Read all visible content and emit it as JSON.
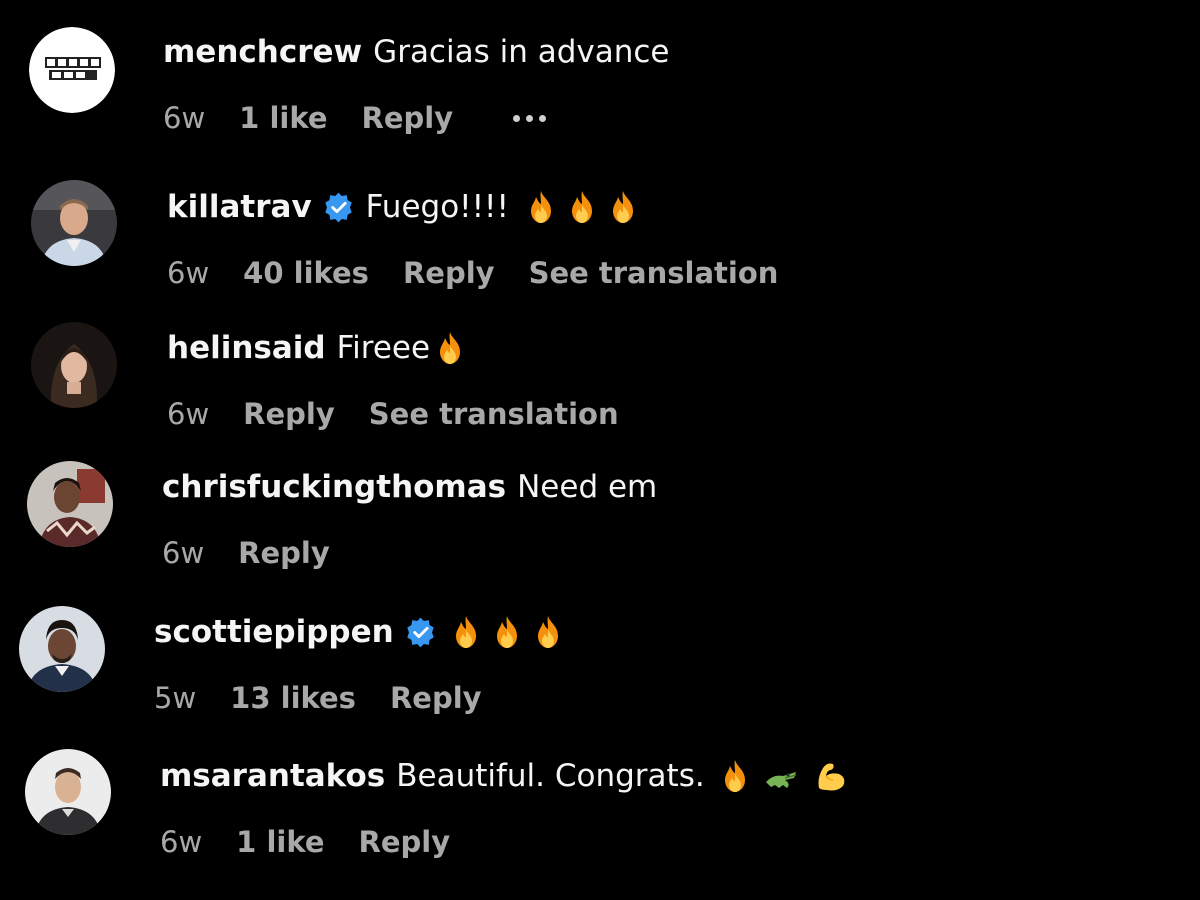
{
  "colors": {
    "background": "#000000",
    "primary_text": "#f5f5f5",
    "secondary_text": "#a8a8a8",
    "verified_badge": "#3897f0"
  },
  "comments": [
    {
      "username": "menchcrew",
      "text": "Gracias in advance",
      "time": "6w",
      "likes": "1 like",
      "reply": "Reply",
      "extra_action": "",
      "verified": false,
      "emojis": [],
      "avatar_text": "MENCH CREW"
    },
    {
      "username": "killatrav",
      "text": "Fuego!!!!",
      "time": "6w",
      "likes": "40 likes",
      "reply": "Reply",
      "extra_action": "See translation",
      "verified": true,
      "emojis": [
        "fire-emoji",
        "fire-emoji",
        "fire-emoji"
      ]
    },
    {
      "username": "helinsaid",
      "text": "Fireee",
      "time": "6w",
      "likes": "",
      "reply": "Reply",
      "extra_action": "See translation",
      "verified": false,
      "emojis": [
        "fire-emoji"
      ]
    },
    {
      "username": "chrisfuckingthomas",
      "text": "Need em",
      "time": "6w",
      "likes": "",
      "reply": "Reply",
      "extra_action": "",
      "verified": false,
      "emojis": []
    },
    {
      "username": "scottiepippen",
      "text": "",
      "time": "5w",
      "likes": "13 likes",
      "reply": "Reply",
      "extra_action": "",
      "verified": true,
      "emojis": [
        "fire-emoji",
        "fire-emoji",
        "fire-emoji"
      ]
    },
    {
      "username": "msarantakos",
      "text": "Beautiful. Congrats.",
      "time": "6w",
      "likes": "1 like",
      "reply": "Reply",
      "extra_action": "",
      "verified": false,
      "emojis": [
        "fire-emoji",
        "crocodile-emoji",
        "flexed-biceps-emoji"
      ]
    }
  ]
}
